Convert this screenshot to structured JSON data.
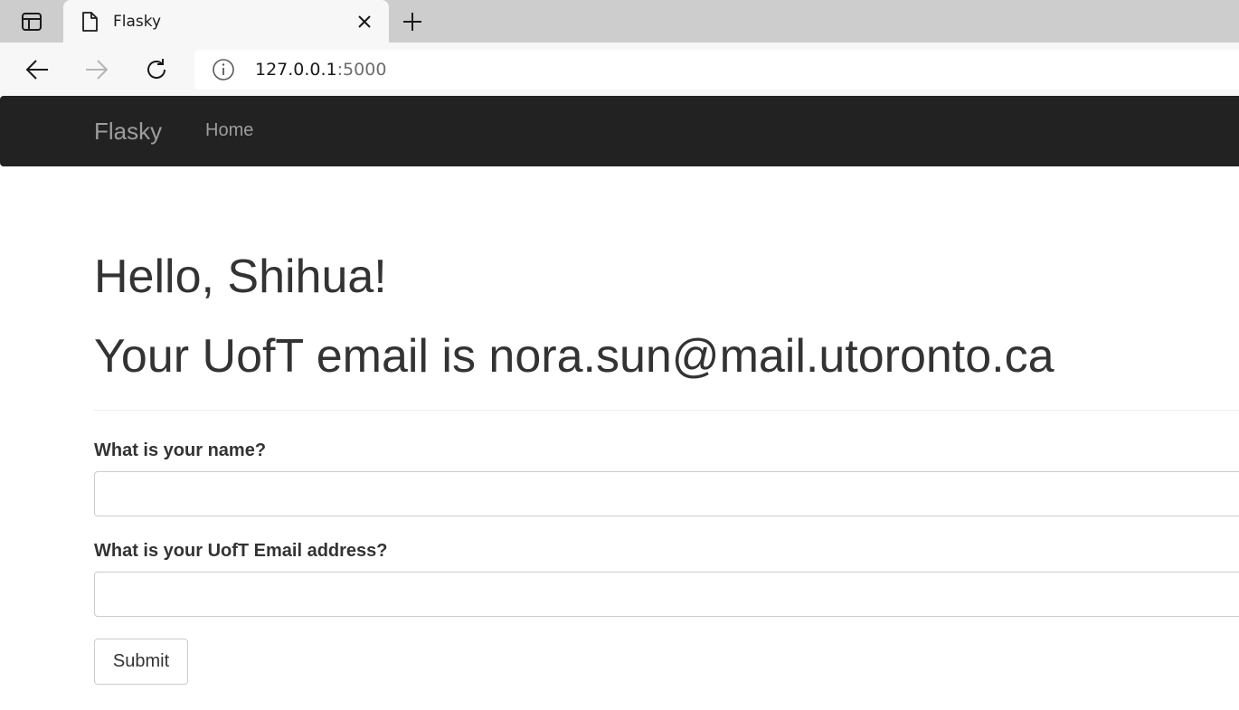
{
  "browser": {
    "tab": {
      "title": "Flasky"
    },
    "address_bar": {
      "url_host": "127.0.0.1",
      "url_port": ":5000"
    },
    "icons": {
      "tab_actions": "tab-actions-icon",
      "tab_page": "page-icon",
      "tab_close": "close-icon",
      "new_tab": "plus-icon",
      "back": "arrow-left-icon",
      "forward": "arrow-right-icon",
      "reload": "reload-icon",
      "site_info": "info-icon"
    }
  },
  "navbar": {
    "brand": "Flasky",
    "links": [
      {
        "label": "Home"
      }
    ]
  },
  "page": {
    "greeting": "Hello, Shihua!",
    "email_message": "Your UofT email is nora.sun@mail.utoronto.ca"
  },
  "form": {
    "name_label": "What is your name?",
    "name_value": "",
    "email_label": "What is your UofT Email address?",
    "email_value": "",
    "submit_label": "Submit"
  },
  "colors": {
    "navbar_bg": "#222222",
    "navbar_text": "#9d9d9d",
    "body_text": "#333333",
    "input_border": "#cccccc",
    "tab_strip_bg": "#cdcdcd",
    "toolbar_bg": "#f7f7f7"
  }
}
